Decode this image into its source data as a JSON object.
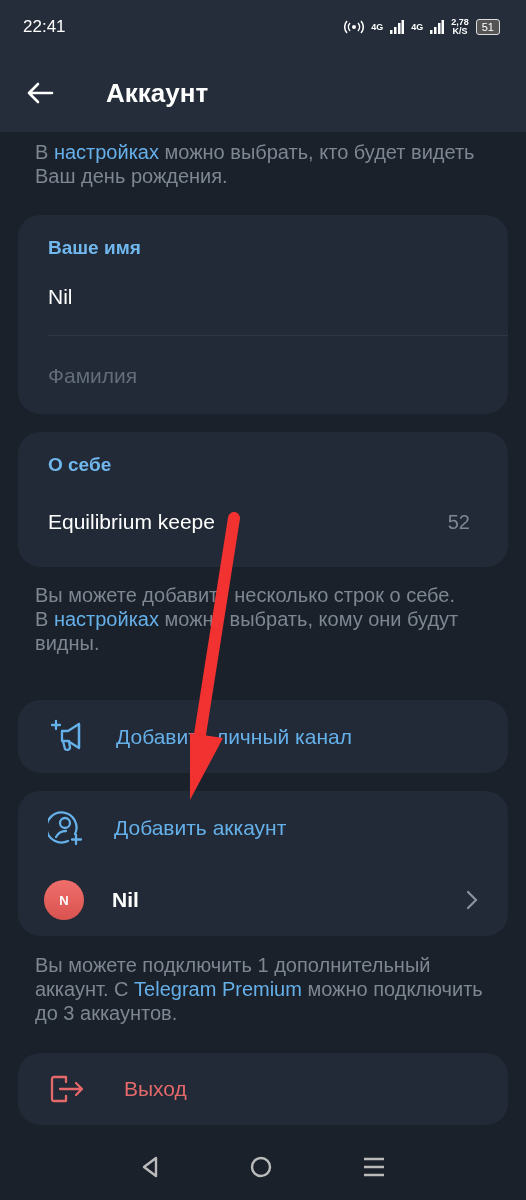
{
  "status_bar": {
    "time": "22:41",
    "network_1": "4G",
    "network_2": "4G",
    "speed": "2,78",
    "speed_unit": "K/S",
    "battery": "51"
  },
  "header": {
    "title": "Аккаунт"
  },
  "birthday_hint": {
    "before": "В ",
    "link": "настройках",
    "after": " можно выбрать, кто будет видеть Ваш день рождения."
  },
  "name_card": {
    "label": "Ваше имя",
    "first_name": "Nil",
    "last_name_placeholder": "Фамилия"
  },
  "bio_card": {
    "label": "О себе",
    "value": "Equilibrium keepe",
    "counter": "52"
  },
  "bio_hint": {
    "lines": [
      [
        [
          {
            "text": "Вы можете добавит",
            "kind": "text"
          }
        ],
        [
          {
            "text": "несколько строк о себе.",
            "kind": "text"
          }
        ]
      ],
      [
        [
          {
            "text": "В ",
            "kind": "text"
          },
          {
            "text": "настройках",
            "kind": "link"
          },
          {
            "text": " можн",
            "kind": "text"
          }
        ],
        [
          {
            "text": "выбрать, кому они будут",
            "kind": "text"
          }
        ]
      ],
      [
        [
          {
            "text": "видны.",
            "kind": "text"
          }
        ]
      ]
    ]
  },
  "channel_button": {
    "label_parts": [
      "Добавит",
      "личный канал"
    ]
  },
  "accounts": {
    "add_label": "Добавить аккаунт",
    "items": [
      {
        "initial": "N",
        "name": "Nil"
      }
    ]
  },
  "accounts_hint": {
    "before": "Вы можете подключить 1 дополнительный аккаунт. С ",
    "link": "Telegram Premium",
    "after": " можно подключить до 3 аккаунтов."
  },
  "logout": {
    "label": "Выход"
  },
  "annotation": {
    "kind": "arrow"
  }
}
